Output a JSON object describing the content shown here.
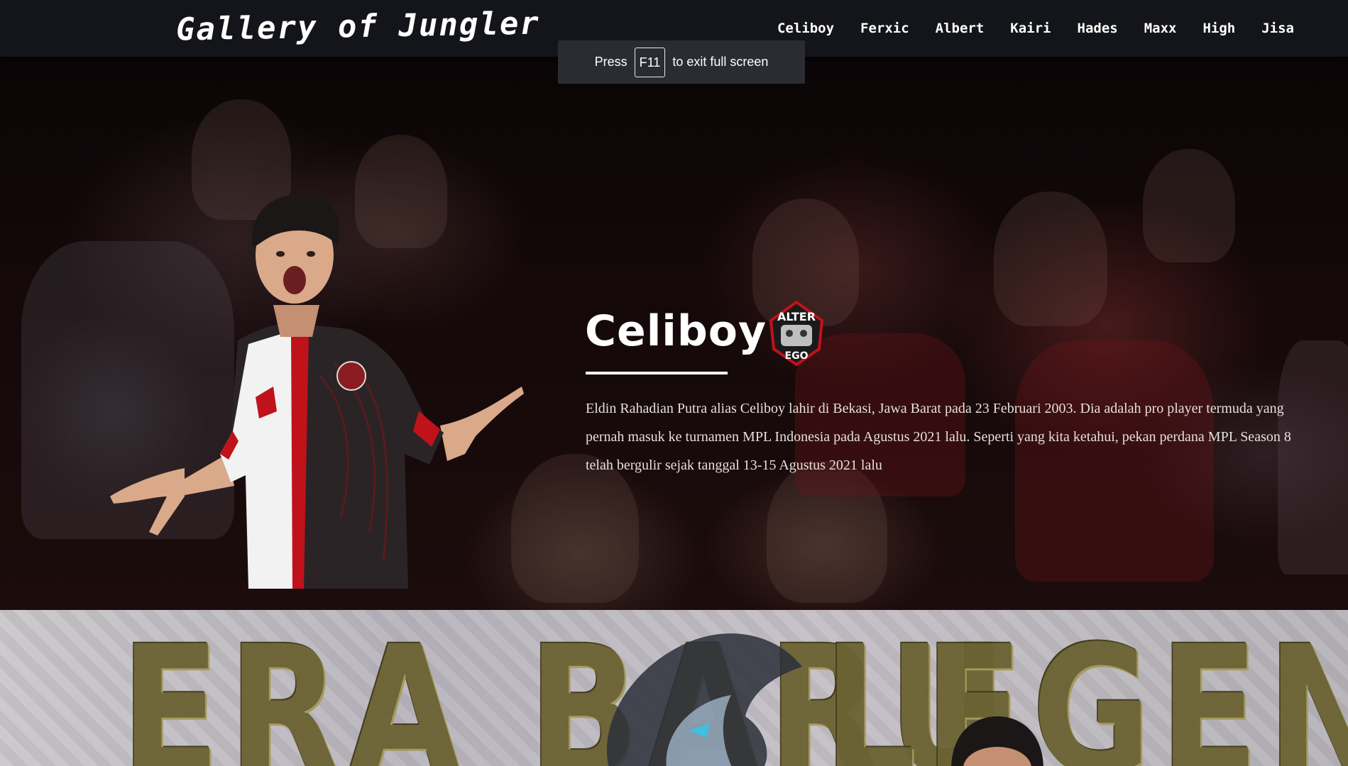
{
  "navbar": {
    "brand": "Gallery of Jungler",
    "links": [
      "Celiboy",
      "Ferxic",
      "Albert",
      "Kairi",
      "Hades",
      "Maxx",
      "High",
      "Jisa"
    ]
  },
  "fullscreen_toast": {
    "before": "Press",
    "key": "F11",
    "after": "to exit full screen"
  },
  "hero": {
    "name": "Celiboy",
    "team_logo_text_top": "ALTER",
    "team_logo_text_bottom": "EGO",
    "description": "Eldin Rahadian Putra alias Celiboy lahir di Bekasi, Jawa Barat pada 23 Februari 2003. Dia adalah pro player termuda yang pernah masuk ke turnamen MPL Indonesia pada Agustus 2021 lalu. Seperti yang kita ketahui, pekan perdana MPL Season 8 telah bergulir sejak tanggal 13-15 Agustus 2021 lalu"
  },
  "section2": {
    "banner_left": "ERA BARU",
    "banner_right": "LEGENDS"
  },
  "colors": {
    "navbar_bg": "#14151a",
    "toast_bg": "#2a2c33",
    "jersey_red": "#c0121b",
    "banner_gold": "#6b6233"
  }
}
